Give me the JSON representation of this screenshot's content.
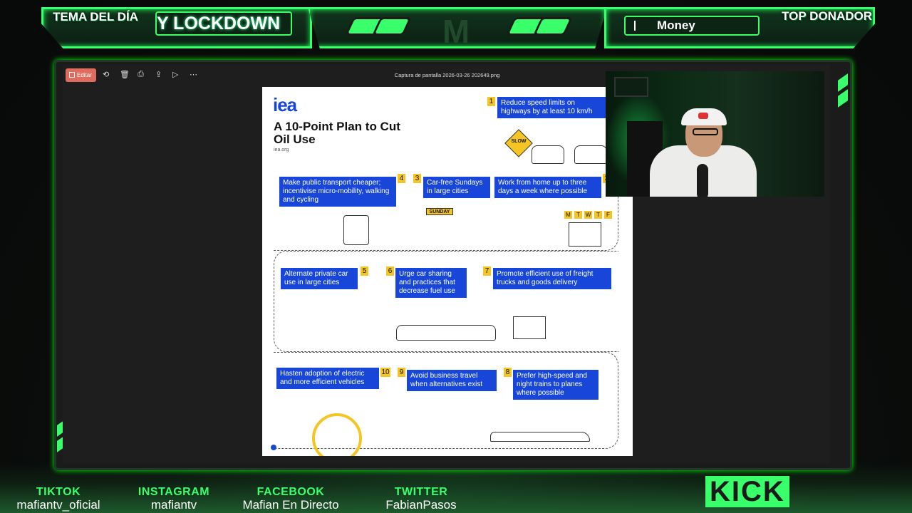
{
  "overlay": {
    "tema_label": "TEMA DEL DÍA",
    "tema_ticker": "Y LOCKDOWN",
    "top_label": "TOP DONADOR",
    "top_donor": "Money",
    "center_logo": "M",
    "accent_color": "#39ff6a"
  },
  "viewer": {
    "edit_label": "Editar",
    "file_title": "Captura de pantalla 2026-03-26 202649.png",
    "toolbar_icons": [
      "rotate-icon",
      "delete-icon",
      "print-icon",
      "share-icon",
      "slideshow-icon",
      "more-icon"
    ]
  },
  "infographic": {
    "logo": "iea",
    "title": "A 10-Point Plan to Cut Oil Use",
    "source": "iea.org",
    "sign_slow": "SLOW",
    "sign_sunday": "SUNDAY",
    "items": [
      {
        "num": "1",
        "text": "Reduce speed limits on highways by at least 10 km/h"
      },
      {
        "num": "4",
        "text": "Make public transport cheaper; incentivise micro-mobility, walking and cycling"
      },
      {
        "num": "3",
        "text": "Car-free Sundays in large cities"
      },
      {
        "num": "2",
        "text": "Work from home up to three days a week where possible"
      },
      {
        "num": "5",
        "text": "Alternate private car use in large cities"
      },
      {
        "num": "6",
        "text": "Urge car sharing and practices that decrease fuel use"
      },
      {
        "num": "7",
        "text": "Promote efficient use of freight trucks and goods delivery"
      },
      {
        "num": "10",
        "text": "Hasten adoption of electric and more efficient vehicles"
      },
      {
        "num": "9",
        "text": "Avoid business travel when alternatives exist"
      },
      {
        "num": "8",
        "text": "Prefer high-speed and night trains to planes where possible"
      }
    ],
    "weekdays": [
      "M",
      "T",
      "W",
      "T",
      "F"
    ]
  },
  "socials": [
    {
      "network": "TIKTOK",
      "handle": "mafiantv_oficial"
    },
    {
      "network": "INSTAGRAM",
      "handle": "mafiantv"
    },
    {
      "network": "FACEBOOK",
      "handle": "Mafian En Directo"
    },
    {
      "network": "TWITTER",
      "handle": "FabianPasos"
    }
  ],
  "platform_logo": "KICK"
}
